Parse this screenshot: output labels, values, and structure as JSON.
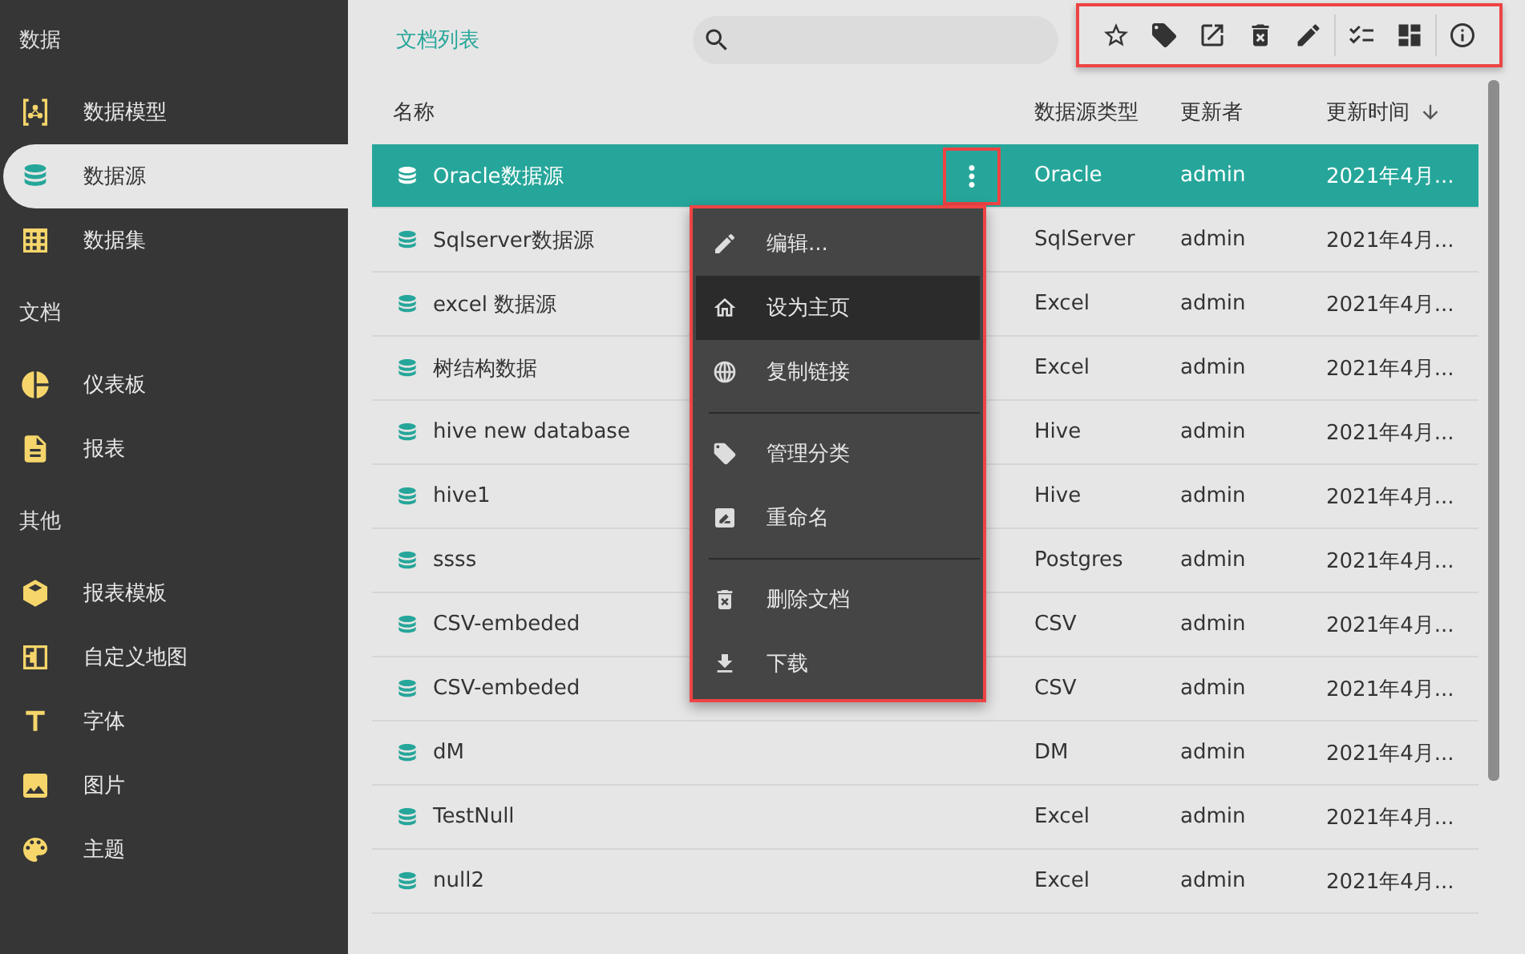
{
  "sidebar": {
    "sections": [
      {
        "heading": "数据",
        "items": [
          {
            "label": "数据模型",
            "selected": false
          },
          {
            "label": "数据源",
            "selected": true
          },
          {
            "label": "数据集",
            "selected": false
          }
        ]
      },
      {
        "heading": "文档",
        "items": [
          {
            "label": "仪表板",
            "selected": false
          },
          {
            "label": "报表",
            "selected": false
          }
        ]
      },
      {
        "heading": "其他",
        "items": [
          {
            "label": "报表模板",
            "selected": false
          },
          {
            "label": "自定义地图",
            "selected": false
          },
          {
            "label": "字体",
            "selected": false
          },
          {
            "label": "图片",
            "selected": false
          },
          {
            "label": "主题",
            "selected": false
          }
        ]
      }
    ]
  },
  "header": {
    "title": "文档列表",
    "toolbar": {
      "highlighted": true
    }
  },
  "table": {
    "columns": [
      {
        "label": "名称",
        "sorted": false
      },
      {
        "label": "数据源类型",
        "sorted": false
      },
      {
        "label": "更新者",
        "sorted": false
      },
      {
        "label": "更新时间",
        "sorted": true
      }
    ],
    "rows": [
      {
        "name": "Oracle数据源",
        "type": "Oracle",
        "updater": "admin",
        "time": "2021年4月...",
        "selected": true,
        "more_button": {
          "highlighted": true
        }
      },
      {
        "name": "Sqlserver数据源",
        "type": "SqlServer",
        "updater": "admin",
        "time": "2021年4月...",
        "selected": false
      },
      {
        "name": "excel 数据源",
        "type": "Excel",
        "updater": "admin",
        "time": "2021年4月...",
        "selected": false
      },
      {
        "name": "树结构数据",
        "type": "Excel",
        "updater": "admin",
        "time": "2021年4月...",
        "selected": false
      },
      {
        "name": "hive new database",
        "type": "Hive",
        "updater": "admin",
        "time": "2021年4月...",
        "selected": false
      },
      {
        "name": "hive1",
        "type": "Hive",
        "updater": "admin",
        "time": "2021年4月...",
        "selected": false
      },
      {
        "name": "ssss",
        "type": "Postgres",
        "updater": "admin",
        "time": "2021年4月...",
        "selected": false
      },
      {
        "name": "CSV-embeded",
        "type": "CSV",
        "updater": "admin",
        "time": "2021年4月...",
        "selected": false
      },
      {
        "name": "CSV-embeded",
        "type": "CSV",
        "updater": "admin",
        "time": "2021年4月...",
        "selected": false
      },
      {
        "name": "dM",
        "type": "DM",
        "updater": "admin",
        "time": "2021年4月...",
        "selected": false
      },
      {
        "name": "TestNull",
        "type": "Excel",
        "updater": "admin",
        "time": "2021年4月...",
        "selected": false
      },
      {
        "name": "null2",
        "type": "Excel",
        "updater": "admin",
        "time": "2021年4月...",
        "selected": false
      }
    ]
  },
  "context_menu": {
    "highlighted": true,
    "groups": [
      [
        {
          "label": "编辑...",
          "highlighted": false
        },
        {
          "label": "设为主页",
          "highlighted": true
        },
        {
          "label": "复制链接",
          "highlighted": false
        }
      ],
      [
        {
          "label": "管理分类",
          "highlighted": false
        },
        {
          "label": "重命名",
          "highlighted": false
        }
      ],
      [
        {
          "label": "删除文档",
          "highlighted": false
        },
        {
          "label": "下载",
          "highlighted": false
        }
      ]
    ]
  }
}
